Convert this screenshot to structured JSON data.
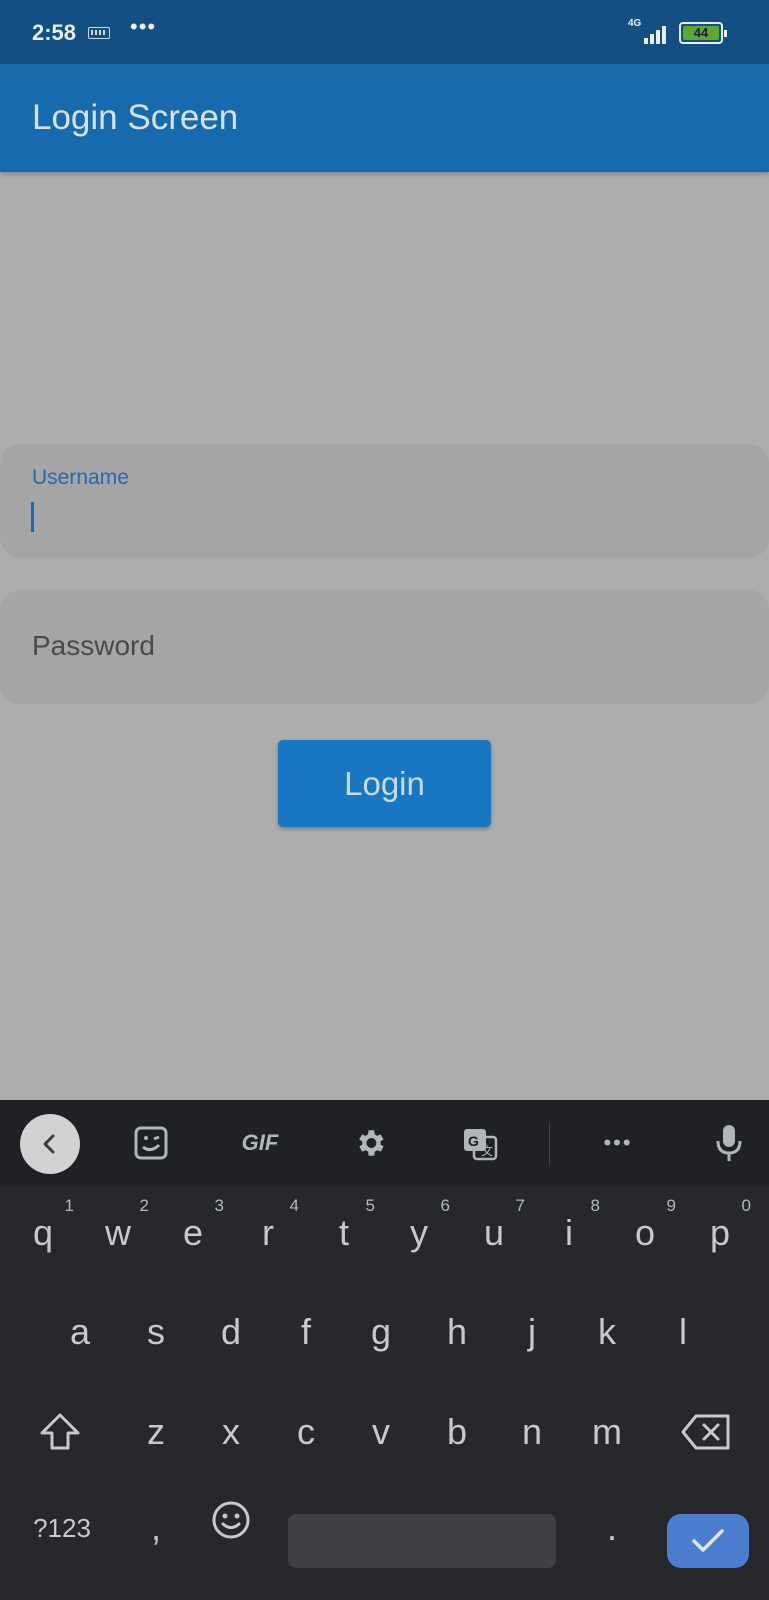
{
  "status": {
    "time": "2:58",
    "network": "4G",
    "battery": "44"
  },
  "appbar": {
    "title": "Login Screen"
  },
  "form": {
    "username": {
      "label": "Username",
      "value": ""
    },
    "password": {
      "placeholder": "Password",
      "value": ""
    },
    "login_label": "Login"
  },
  "keyboard": {
    "row1": [
      {
        "k": "q",
        "n": "1"
      },
      {
        "k": "w",
        "n": "2"
      },
      {
        "k": "e",
        "n": "3"
      },
      {
        "k": "r",
        "n": "4"
      },
      {
        "k": "t",
        "n": "5"
      },
      {
        "k": "y",
        "n": "6"
      },
      {
        "k": "u",
        "n": "7"
      },
      {
        "k": "i",
        "n": "8"
      },
      {
        "k": "o",
        "n": "9"
      },
      {
        "k": "p",
        "n": "0"
      }
    ],
    "row2": [
      "a",
      "s",
      "d",
      "f",
      "g",
      "h",
      "j",
      "k",
      "l"
    ],
    "row3": [
      "z",
      "x",
      "c",
      "v",
      "b",
      "n",
      "m"
    ],
    "symbols_label": "?123",
    "comma": ",",
    "period": ".",
    "toolbar_gif": "GIF"
  },
  "colors": {
    "appbar": "#176aad",
    "accent": "#1e6bb1",
    "button": "#1976c2",
    "keyboard_enter": "#4c7dcf"
  }
}
